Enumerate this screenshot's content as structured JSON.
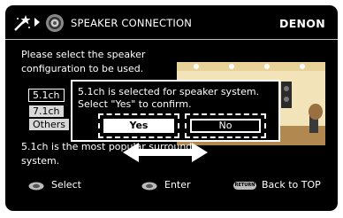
{
  "header": {
    "title": "SPEAKER CONNECTION",
    "brand": "DENON",
    "icons": [
      "wand-icon",
      "chevron-right-icon",
      "speaker-setup-icon"
    ]
  },
  "intro_text": "Please select the speaker configuration to be used.",
  "options": [
    {
      "label": "5.1ch",
      "selected": true
    },
    {
      "label": "7.1ch",
      "selected": false
    },
    {
      "label": "Others",
      "selected": false
    }
  ],
  "description": "5.1ch is the most popular surround system.",
  "dialog": {
    "message_line1": "5.1ch is selected for speaker system.",
    "message_line2": "Select \"Yes\" to confirm.",
    "yes_label": "Yes",
    "no_label": "No"
  },
  "footer": {
    "select_label": "Select",
    "enter_label": "Enter",
    "return_badge": "RETURN",
    "back_label": "Back to TOP"
  },
  "colors": {
    "background": "#000000",
    "text": "#ffffff",
    "room_wall": "#f2e3b8",
    "room_floor": "#b08850",
    "highlight": "#ffffff"
  }
}
